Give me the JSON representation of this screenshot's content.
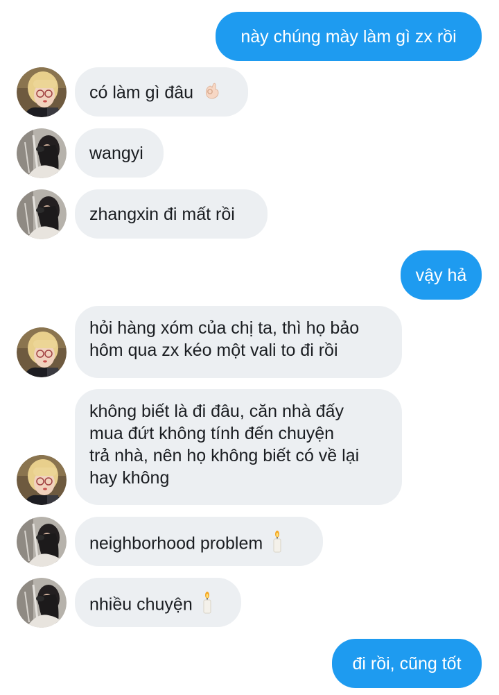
{
  "messages": [
    {
      "sender": "me",
      "text": "này chúng mày làm gì zx rồi"
    },
    {
      "sender": "friend-blonde",
      "text": "có làm gì đâu",
      "emoji": "ok-hand-emoji"
    },
    {
      "sender": "friend-dark",
      "text": "wangyi"
    },
    {
      "sender": "friend-dark",
      "text": "zhangxin đi mất rồi"
    },
    {
      "sender": "me",
      "text": "vậy hả"
    },
    {
      "sender": "friend-blonde",
      "lines": [
        "hỏi hàng xóm của chị ta, thì họ bảo",
        "hôm qua zx kéo một vali to đi rồi"
      ]
    },
    {
      "sender": "friend-blonde",
      "lines": [
        "không biết là đi đâu, căn nhà đấy",
        "mua đứt không tính đến chuyện",
        "trả nhà, nên họ không biết có về lại",
        "hay không"
      ]
    },
    {
      "sender": "friend-dark",
      "text": "neighborhood problem",
      "emoji": "candle-emoji"
    },
    {
      "sender": "friend-dark",
      "text": "nhiều chuyện",
      "emoji": "candle-emoji"
    },
    {
      "sender": "me",
      "text": "đi rồi, cũng tốt"
    }
  ],
  "colors": {
    "outgoing_bubble": "#1e9bf0",
    "incoming_bubble": "#eceff2",
    "outgoing_text": "#ffffff",
    "incoming_text": "#1a1d21"
  }
}
